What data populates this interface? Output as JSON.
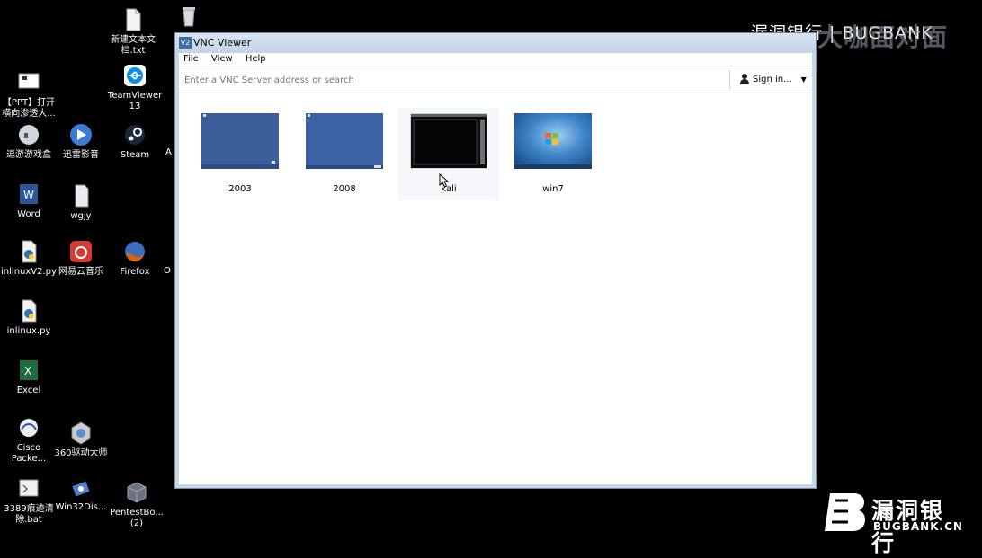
{
  "desktop": {
    "icons": [
      {
        "label": "新建文本文\n档.txt",
        "icon": "text-file-icon"
      },
      {
        "label": "",
        "icon": "recycle-bin-icon"
      },
      {
        "label": "【PPT】打开\n横向渗透大...",
        "icon": "ppt-shortcut-icon"
      },
      {
        "label": "TeamViewer\n13",
        "icon": "teamviewer-icon"
      },
      {
        "label": "逗游游戏盒",
        "icon": "game-box-icon"
      },
      {
        "label": "迅雷影音",
        "icon": "xunlei-player-icon"
      },
      {
        "label": "Steam",
        "icon": "steam-icon"
      },
      {
        "label": "A",
        "icon": "partial-icon"
      },
      {
        "label": "Word",
        "icon": "word-icon"
      },
      {
        "label": "wgjy",
        "icon": "folder-file-icon"
      },
      {
        "label": "inlinuxV2.py",
        "icon": "python-file-icon"
      },
      {
        "label": "网易云音乐",
        "icon": "netease-music-icon"
      },
      {
        "label": "Firefox",
        "icon": "firefox-icon"
      },
      {
        "label": "O",
        "icon": "partial-icon"
      },
      {
        "label": "inlinux.py",
        "icon": "python-file-icon"
      },
      {
        "label": "Excel",
        "icon": "excel-icon"
      },
      {
        "label": "Cisco\nPacke...",
        "icon": "cisco-packet-tracer-icon"
      },
      {
        "label": "360驱动大师",
        "icon": "driver-master-icon"
      },
      {
        "label": "3389痕迹清\n除.bat",
        "icon": "bat-file-icon"
      },
      {
        "label": "Win32Dis...",
        "icon": "win32disk-icon"
      },
      {
        "label": "PentestBo...\n(2)",
        "icon": "pentestbox-icon"
      }
    ]
  },
  "watermark": {
    "top_text": "漏洞银行 | BUGBANK",
    "top_overlay": "大咖面对面",
    "logo_name": "漏洞银行",
    "logo_sub": "BUGBANK.CN"
  },
  "vnc": {
    "title": "VNC Viewer",
    "menu": [
      "File",
      "View",
      "Help"
    ],
    "search_placeholder": "Enter a VNC Server address or search",
    "sign_in": "Sign in...",
    "connections": [
      {
        "name": "2003",
        "style": "blue-desktop"
      },
      {
        "name": "2008",
        "style": "blue-desktop"
      },
      {
        "name": "kali",
        "style": "dark-terminal"
      },
      {
        "name": "win7",
        "style": "win7-desktop"
      }
    ]
  },
  "colors": {
    "desktop_bg": "#000000",
    "window_frame": "#c9d6e6",
    "thumb_blue": "#3c5f9a",
    "thumb_dark": "#0a0a0a"
  }
}
